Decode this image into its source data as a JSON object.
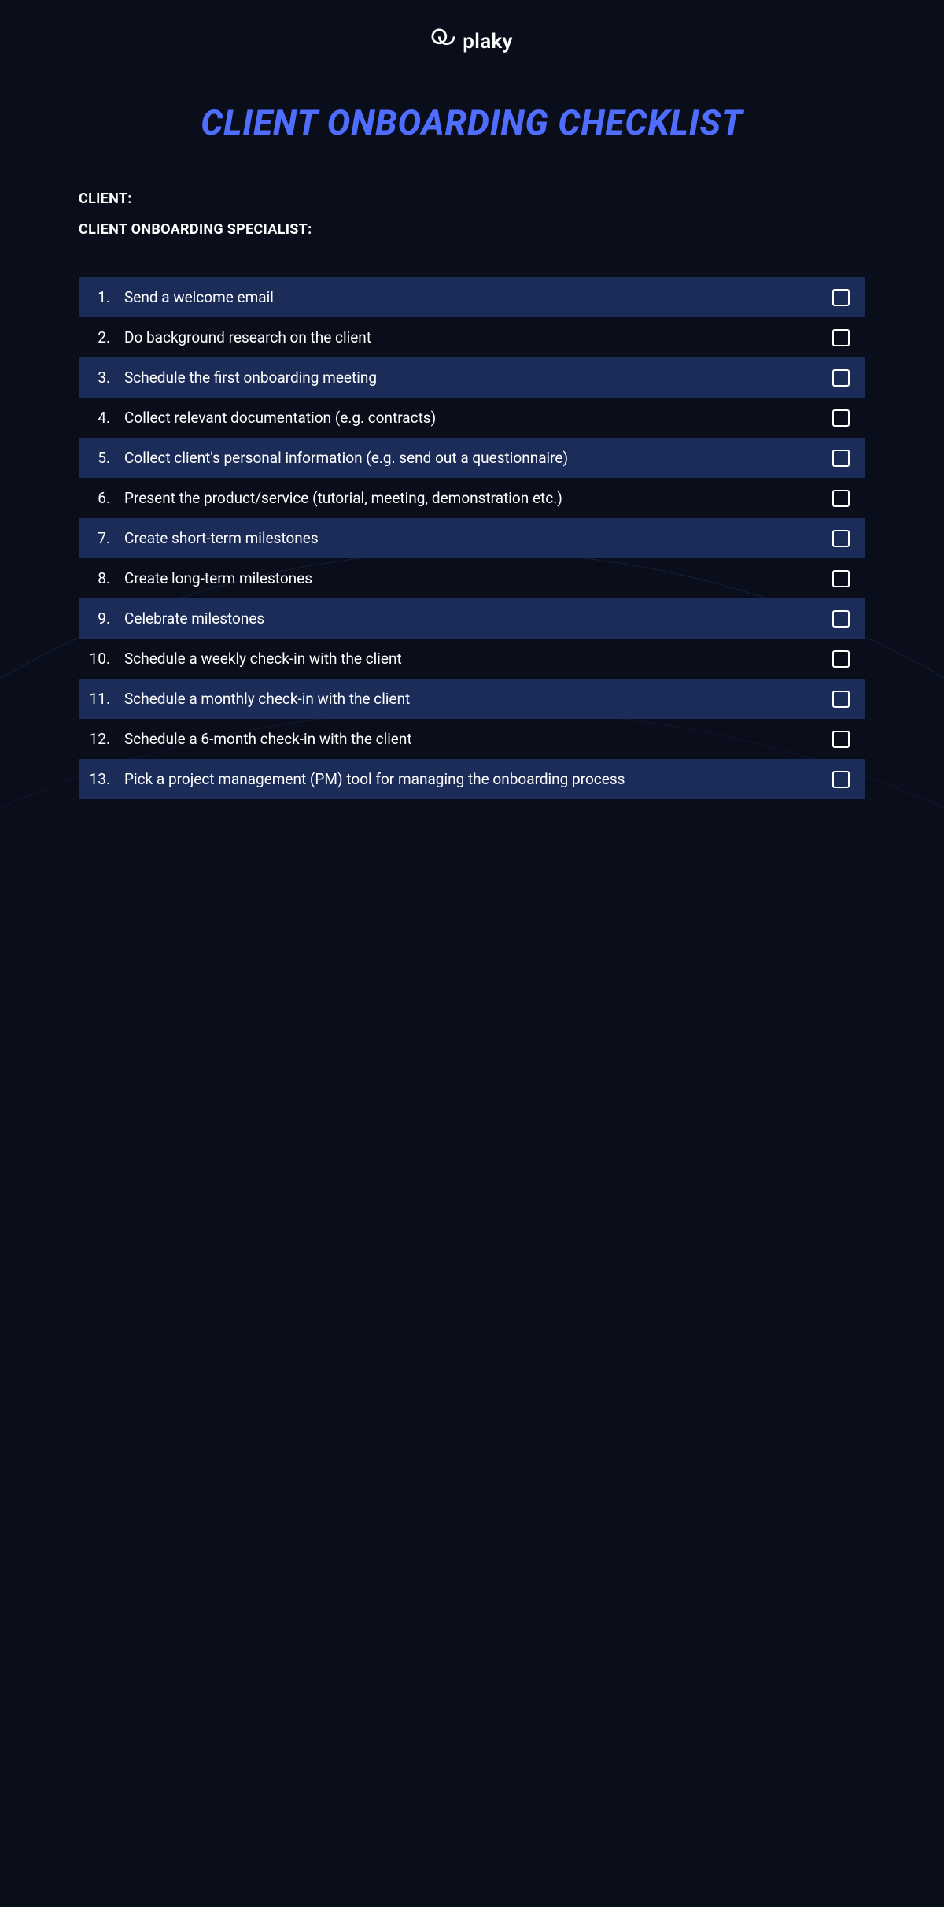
{
  "brand": {
    "name": "plaky"
  },
  "title": "CLIENT ONBOARDING CHECKLIST",
  "meta": {
    "client_label": "CLIENT:",
    "specialist_label": "CLIENT ONBOARDING SPECIALIST:"
  },
  "items": [
    {
      "num": "1.",
      "text": "Send a welcome email"
    },
    {
      "num": "2.",
      "text": "Do background research on the client"
    },
    {
      "num": "3.",
      "text": "Schedule the first onboarding meeting"
    },
    {
      "num": "4.",
      "text": "Collect relevant documentation (e.g. contracts)"
    },
    {
      "num": "5.",
      "text": "Collect client's personal information (e.g. send out a questionnaire)"
    },
    {
      "num": "6.",
      "text": "Present the product/service (tutorial, meeting, demonstration etc.)"
    },
    {
      "num": "7.",
      "text": "Create short-term milestones"
    },
    {
      "num": "8.",
      "text": "Create long-term milestones"
    },
    {
      "num": "9.",
      "text": "Celebrate milestones"
    },
    {
      "num": "10.",
      "text": "Schedule a weekly check-in with the client"
    },
    {
      "num": "11.",
      "text": "Schedule a monthly check-in with the client"
    },
    {
      "num": "12.",
      "text": "Schedule a 6-month check-in with the client"
    },
    {
      "num": "13.",
      "text": "Pick a project management (PM) tool for managing the onboarding process"
    }
  ]
}
